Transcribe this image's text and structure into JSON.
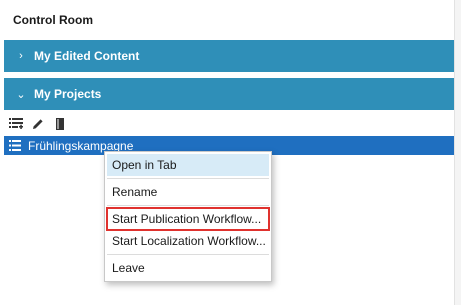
{
  "panel": {
    "title": "Control Room"
  },
  "sections": [
    {
      "label": "My Edited Content",
      "expanded": false
    },
    {
      "label": "My Projects",
      "expanded": true
    }
  ],
  "toolbar": {
    "icons": [
      "list-add-icon",
      "pencil-icon",
      "book-icon"
    ]
  },
  "tree": {
    "selected_item": "Frühlingskampagne",
    "item_icon": "list-icon"
  },
  "context_menu": {
    "items": [
      "Open in Tab",
      "Rename",
      "Start Publication Workflow...",
      "Start Localization Workflow...",
      "Leave"
    ],
    "hovered_item": "Open in Tab",
    "highlighted_item": "Start Publication Workflow..."
  },
  "colors": {
    "section_header": "#2f8fb8",
    "selected_row": "#1f6fc0",
    "menu_hover": "#d7ebf7",
    "highlight_box": "#e0322e"
  }
}
